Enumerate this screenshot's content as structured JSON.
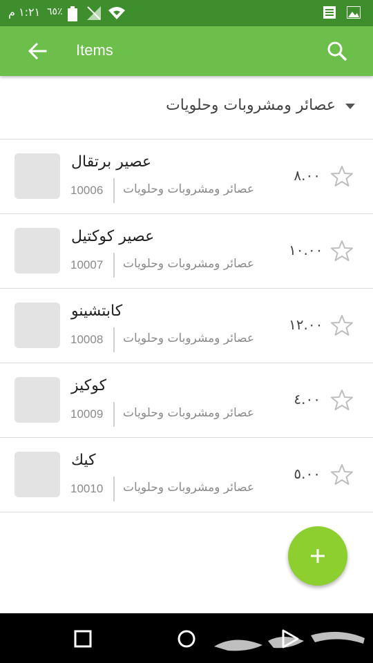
{
  "status_bar": {
    "time": "١:٢١ م",
    "battery": "٦٥٪"
  },
  "app_bar": {
    "title": "Items"
  },
  "category_filter": {
    "selected": "عصائر ومشروبات وحلويات"
  },
  "items": [
    {
      "name": "عصير برتقال",
      "category": "عصائر ومشروبات وحلويات",
      "code": "10006",
      "price": "٨.٠٠"
    },
    {
      "name": "عصير كوكتيل",
      "category": "عصائر ومشروبات وحلويات",
      "code": "10007",
      "price": "١٠.٠٠"
    },
    {
      "name": "كابتشينو",
      "category": "عصائر ومشروبات وحلويات",
      "code": "10008",
      "price": "١٢.٠٠"
    },
    {
      "name": "كوكيز",
      "category": "عصائر ومشروبات وحلويات",
      "code": "10009",
      "price": "٤.٠٠"
    },
    {
      "name": "كيك",
      "category": "عصائر ومشروبات وحلويات",
      "code": "10010",
      "price": "٥.٠٠"
    }
  ],
  "colors": {
    "status_bar": "#3e8e2e",
    "app_bar": "#6cbf4b",
    "fab": "#8ccf2e"
  },
  "icons": [
    "back-arrow-icon",
    "search-icon",
    "dropdown-caret-icon",
    "star-outline-icon",
    "add-icon",
    "back-nav-icon",
    "home-nav-icon",
    "recents-nav-icon",
    "wifi-icon",
    "signal-icon",
    "battery-icon",
    "notes-icon",
    "image-icon"
  ]
}
